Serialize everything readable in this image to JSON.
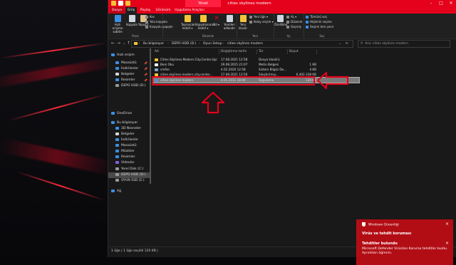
{
  "titlebar": {
    "context_tab": "Yönet",
    "title": "cities skylines modern",
    "controls": [
      "–",
      "□",
      "✕"
    ]
  },
  "tabs": [
    {
      "label": "Dosya",
      "kind": "file"
    },
    {
      "label": "Giriş",
      "kind": "active"
    },
    {
      "label": "Paylaş",
      "kind": "normal"
    },
    {
      "label": "Görünüm",
      "kind": "normal"
    },
    {
      "label": "Uygulama Araçları",
      "kind": "normal"
    }
  ],
  "ribbon": {
    "groups": {
      "pano": "Pano",
      "duzenle": "Düzenle",
      "yeni": "Yeni",
      "ac": "Aç",
      "sec": "Seç"
    },
    "pin": "Hızlı erişime sabitle",
    "copy": "Kopyala",
    "paste": "Yapıştır",
    "cut": "Kes",
    "copy_path": "Yolu kopyala",
    "paste_shortcut": "Kısayolu yapıştır",
    "move_to": "Taşınacak hedef ▾",
    "copy_to": "Kopyalanacak hedef ▾",
    "delete": "Sil ▾",
    "rename": "Yeniden adlandır",
    "new_folder": "Yeni klasör",
    "new_item": "Yeni öğe ▾",
    "easy_access": "Kolay erişim ▾",
    "properties": "Özellikler",
    "open": "Aç ▾",
    "edit": "Düzenle",
    "history": "Geçmiş",
    "select_all": "Tümünü seç",
    "select_none": "Hiçbirini seçme",
    "invert_sel": "Seçimi ters çevir"
  },
  "address": {
    "crumbs": [
      "Bu bilgisayar",
      "DEPO HDD (D:)",
      "Oyun Setup",
      "cities skylines modern"
    ],
    "search_placeholder": "Ara: cities skylines modern"
  },
  "sidebar": {
    "items": [
      {
        "label": "Hızlı erişim",
        "color": "#3a8ee6",
        "pin": "",
        "indent": 0
      },
      {
        "label": "Masaüstü",
        "color": "#3a8ee6",
        "pin": "📌",
        "indent": 1
      },
      {
        "label": "İndirilenler",
        "color": "#3a8ee6",
        "pin": "📌",
        "indent": 1
      },
      {
        "label": "Belgeler",
        "color": "#cfd8e0",
        "pin": "📌",
        "indent": 1
      },
      {
        "label": "Resimler",
        "color": "#3a8ee6",
        "pin": "📌",
        "indent": 1
      },
      {
        "label": "DEPO HDD (D:)",
        "color": "#9a9a9a",
        "pin": "",
        "indent": 1
      },
      {
        "label": "OneDrive",
        "color": "#3a8ee6",
        "pin": "",
        "indent": 0
      },
      {
        "label": "Bu bilgisayar",
        "color": "#3a8ee6",
        "pin": "",
        "indent": 0
      },
      {
        "label": "3D Nesneler",
        "color": "#3a8ee6",
        "pin": "",
        "indent": 1
      },
      {
        "label": "Belgeler",
        "color": "#cfd8e0",
        "pin": "",
        "indent": 1
      },
      {
        "label": "İndirilenler",
        "color": "#3a8ee6",
        "pin": "",
        "indent": 1
      },
      {
        "label": "Masaüstü",
        "color": "#3a8ee6",
        "pin": "",
        "indent": 1
      },
      {
        "label": "Müzikler",
        "color": "#3a8ee6",
        "pin": "",
        "indent": 1
      },
      {
        "label": "Resimler",
        "color": "#3a8ee6",
        "pin": "",
        "indent": 1
      },
      {
        "label": "Videolar",
        "color": "#8a5ae6",
        "pin": "",
        "indent": 1
      },
      {
        "label": "Yerel Disk (C:)",
        "color": "#9a9a9a",
        "pin": "",
        "indent": 1
      },
      {
        "label": "DEPO HDD (D:)",
        "color": "#9a9a9a",
        "pin": "",
        "indent": 1,
        "selected": true
      },
      {
        "label": "OYUN SSD (E:)",
        "color": "#9a9a9a",
        "pin": "",
        "indent": 1
      },
      {
        "label": "Ağ",
        "color": "#3a8ee6",
        "pin": "",
        "indent": 0
      }
    ]
  },
  "columns": {
    "name": "Ad",
    "date": "Değiştirme tarihi",
    "type": "Tür",
    "size": "Boyut"
  },
  "files": [
    {
      "name": "Cities.Skylines.Modern.City.Center.Updat...",
      "date": "17.08.2021 12:58",
      "type": "Dosya klasörü",
      "size": "",
      "color": "#f3c33a"
    },
    {
      "name": "Beni Oku",
      "date": "29.08.2015 21:07",
      "type": "Metin Belgesi",
      "size": "1 KB",
      "color": "#ffffff"
    },
    {
      "name": "cmfen",
      "date": "4.02.2020 12:58",
      "type": "Sistem Bilgisi Do...",
      "size": "4 KB",
      "color": "#7aa6d8"
    },
    {
      "name": "cities.skylines.modern.city.center...",
      "date": "17.08.2021 12:56",
      "type": "Sıkıştırılmış...",
      "size": "6.402.338 KB",
      "color": "#f3c33a"
    },
    {
      "name": "cities skylines modern",
      "date": "4.01.2011 18:40",
      "type": "Uygulama",
      "size": "120 KB",
      "color": "#5f8fd9",
      "selected": true
    }
  ],
  "status": "1 öğe  |  1 öğe seçildi  120 KB  |",
  "toast": {
    "app": "Windows Güvenliği",
    "title": "Virüs ve tehdit koruması",
    "subtitle": "Tehditler bulundu",
    "body": "Microsoft Defender Virüsten Koruma tehditler buldu. Ayrıntıları öğrenin."
  },
  "colors": {
    "accent": "#e5001b",
    "toast_bg": "#b20d14",
    "window_bg": "#191919"
  }
}
